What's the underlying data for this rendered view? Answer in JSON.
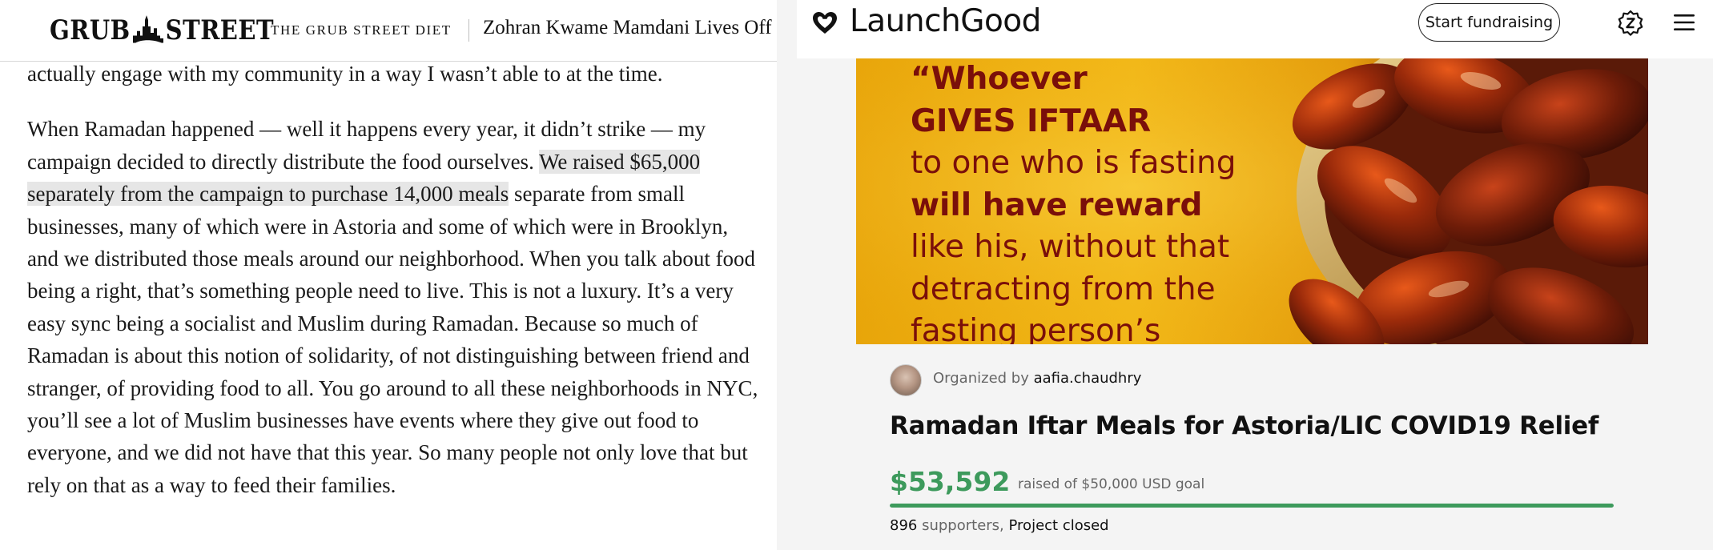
{
  "grubstreet": {
    "logo": "GRUB STREET",
    "logo_left": "GRUB",
    "logo_right": "STREET",
    "section": "THE GRUB STREET DIET",
    "headline": "Zohran Kwame Mamdani Lives Off N",
    "prev_text": "actually engage with my community in a way I wasn’t able to at the time.",
    "paragraph_before": "When Ramadan happened — well it happens every year, it didn’t strike — my campaign decided to directly distribute the food ourselves. ",
    "paragraph_highlight": "We raised $65,000 separately from the campaign to purchase 14,000 meals",
    "paragraph_after": " separate from small businesses, many of which were in Astoria and some of which were in Brooklyn, and we distributed those meals around our neighborhood. When you talk about food being a right, that’s something people need to live. This is not a luxury. It’s a very easy sync being a socialist and Muslim during Ramadan. Because so much of Ramadan is about this notion of solidarity, of not distinguishing between friend and stranger, of providing food to all. You go around to all these neighborhoods in NYC, you’ll see a lot of Muslim businesses have events where they give out food to everyone, and we did not have that this year. So many people not only love that but rely on that as a way to feed their families."
  },
  "launchgood": {
    "brand": "LaunchGood",
    "start_button": "Start fundraising",
    "icons": {
      "logo": "heart-icon",
      "zakat": "zakat-badge-icon",
      "menu": "hamburger-menu-icon"
    },
    "hero_quote": [
      "“Whoever",
      "GIVES IFTAAR",
      "to one who is fasting",
      "will have reward",
      "like his, without that",
      "detracting from the",
      "fasting person’s"
    ],
    "organized_by_label": "Organized by",
    "organizer": "aafia.chaudhry",
    "title": "Ramadan Iftar Meals for Astoria/LIC COVID19 Relief",
    "raised": "$53,592",
    "goal_text": "raised of $50,000 USD goal",
    "progress_fraction": 1.0,
    "supporters_count": "896",
    "supporters_label": "supporters,",
    "status": "Project closed",
    "accent_color": "#3d9a5c"
  }
}
